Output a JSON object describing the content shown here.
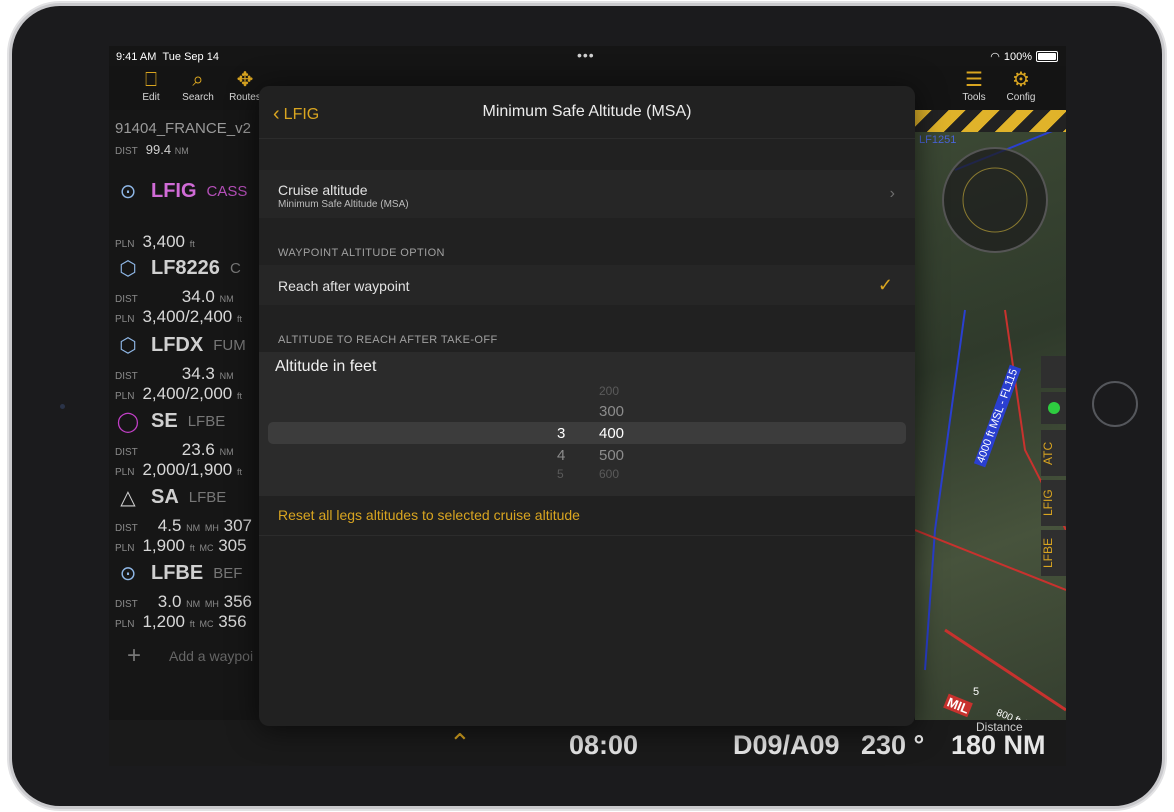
{
  "status_bar": {
    "time": "9:41 AM",
    "date": "Tue Sep 14",
    "dots": "•••",
    "battery": "100%"
  },
  "toolbar": {
    "items": [
      {
        "label": "Edit",
        "icon": "padlock-icon"
      },
      {
        "label": "Search",
        "icon": "search-icon"
      },
      {
        "label": "Routes",
        "icon": "route-icon"
      },
      {
        "label": "Tools",
        "icon": "menu-icon"
      },
      {
        "label": "Config",
        "icon": "gear-icon"
      }
    ]
  },
  "route": {
    "name": "91404_FRANCE_v2",
    "dist_label": "DIST",
    "dist_value": "99.4",
    "dist_unit": "NM",
    "add_waypoint": "Add a waypoi"
  },
  "waypoints": [
    {
      "id": "LFIG",
      "sub": "CASS",
      "pln": "3,400",
      "pln_unit": "ft",
      "accent": "#d06bd6"
    },
    {
      "id": "LF8226",
      "sub": "C",
      "dist": "34.0",
      "pln": "3,400/2,400",
      "pln_unit": "ft"
    },
    {
      "id": "LFDX",
      "sub": "FUM",
      "dist": "34.3",
      "pln": "2,400/2,000",
      "pln_unit": "ft"
    },
    {
      "id": "SE",
      "sub": "LFBE",
      "dist": "23.6",
      "pln": "2,000/1,900",
      "pln_unit": "ft"
    },
    {
      "id": "SA",
      "sub": "LFBE",
      "dist": "4.5",
      "mh": "307",
      "pln": "1,900",
      "mc": "305",
      "pln_unit": "ft"
    },
    {
      "id": "LFBE",
      "sub": "BEF",
      "dist": "3.0",
      "mh": "356",
      "pln": "1,200",
      "mc": "356",
      "pln_unit": "ft"
    }
  ],
  "labels": {
    "dist": "DIST",
    "pln": "PLN",
    "nm": "NM",
    "mh": "MH",
    "mc": "MC"
  },
  "map": {
    "airspace_label": "LF1251",
    "msl_label": "4000 ft MSL - FL115",
    "mil_label": "MIL",
    "agl_label": "800 ft AGL",
    "side_tabs": [
      "ATC",
      "LFIG",
      "LFBE"
    ],
    "scale": "5"
  },
  "bottom_bar": {
    "time": "08:00",
    "dist_label": "Distance",
    "dept": "D09/A09",
    "heading": "230 °",
    "distance": "180 NM"
  },
  "modal": {
    "back_label": "LFIG",
    "title": "Minimum Safe Altitude (MSA)",
    "cruise": {
      "title": "Cruise altitude",
      "subtitle": "Minimum Safe Altitude (MSA)"
    },
    "waypoint_section": "WAYPOINT ALTITUDE OPTION",
    "waypoint_option": "Reach after waypoint",
    "altitude_section": "ALTITUDE TO REACH AFTER TAKE-OFF",
    "picker": {
      "title": "Altitude in feet",
      "left_values": [
        "3",
        "4",
        "5"
      ],
      "right_values": [
        "200",
        "300",
        "400",
        "500",
        "600"
      ],
      "selected": "400"
    },
    "reset_label": "Reset all legs altitudes to selected cruise altitude"
  }
}
